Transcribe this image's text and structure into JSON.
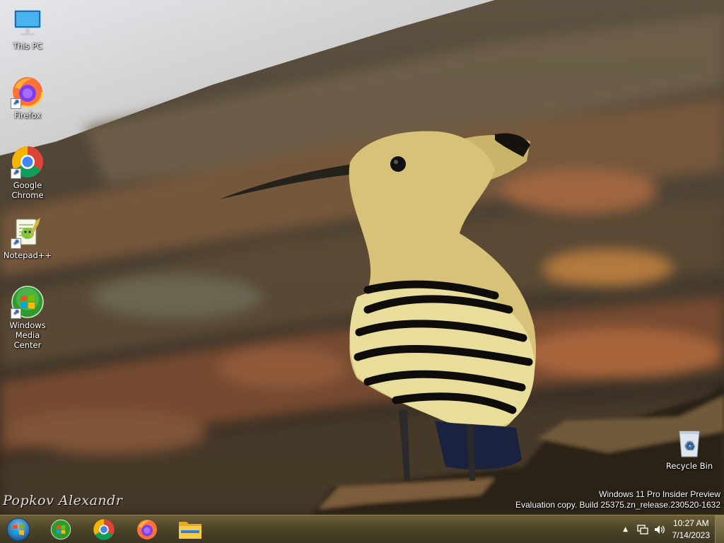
{
  "desktop": {
    "icons": [
      {
        "label": "This PC",
        "icon": "monitor-icon"
      },
      {
        "label": "Firefox",
        "icon": "firefox-icon"
      },
      {
        "label": "Google Chrome",
        "icon": "chrome-icon"
      },
      {
        "label": "Notepad++",
        "icon": "notepadpp-icon"
      },
      {
        "label": "Windows Media Center",
        "icon": "media-center-icon"
      },
      {
        "label": "Recycle Bin",
        "icon": "recycle-bin-icon"
      }
    ],
    "signature": "Popkov Alexandr",
    "watermark": {
      "line1": "Windows 11 Pro Insider Preview",
      "line2": "Evaluation copy. Build 25375.zn_release.230520-1632"
    }
  },
  "taskbar": {
    "pinned": [
      {
        "name": "Windows Media Center",
        "icon": "media-center-icon"
      },
      {
        "name": "Google Chrome",
        "icon": "chrome-icon"
      },
      {
        "name": "Firefox",
        "icon": "firefox-icon"
      },
      {
        "name": "File Explorer",
        "icon": "folder-icon"
      }
    ],
    "tray": {
      "chevron": "▲",
      "time": "10:27 AM",
      "date": "7/14/2023"
    }
  },
  "colors": {
    "taskbar": "#4e462a",
    "accent": "#1a6fd1"
  }
}
